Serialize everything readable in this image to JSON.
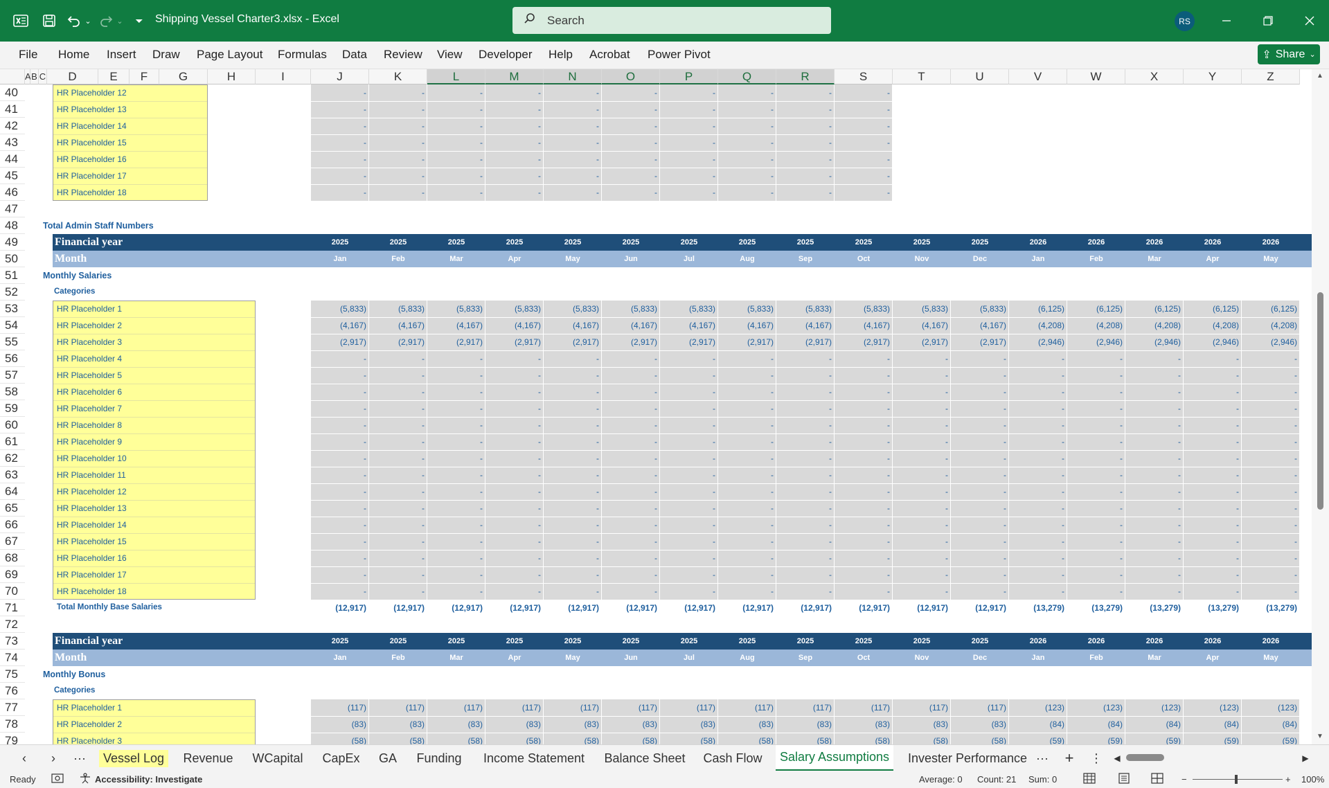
{
  "app": {
    "title": "Shipping Vessel Charter3.xlsx  -  Excel",
    "search_placeholder": "Search",
    "avatar_initials": "RS",
    "share_label": "Share"
  },
  "menu": [
    "File",
    "Home",
    "Insert",
    "Draw",
    "Page Layout",
    "Formulas",
    "Data",
    "Review",
    "View",
    "Developer",
    "Help",
    "Acrobat",
    "Power Pivot"
  ],
  "columns": [
    "A",
    "B",
    "C",
    "D",
    "E",
    "F",
    "G",
    "H",
    "I",
    "J",
    "K",
    "L",
    "M",
    "N",
    "O",
    "P",
    "Q",
    "R",
    "S",
    "T",
    "U",
    "V",
    "W",
    "X",
    "Y",
    "Z"
  ],
  "selected_columns": [
    "L",
    "M",
    "N",
    "O",
    "P",
    "Q",
    "R"
  ],
  "rows": [
    "40",
    "41",
    "42",
    "43",
    "44",
    "45",
    "46",
    "47",
    "48",
    "49",
    "50",
    "51",
    "52",
    "53",
    "54",
    "55",
    "56",
    "57",
    "58",
    "59",
    "60",
    "61",
    "62",
    "63",
    "64",
    "65",
    "66",
    "67",
    "68",
    "69",
    "70",
    "71",
    "72",
    "73",
    "74",
    "75",
    "76",
    "77",
    "78",
    "79"
  ],
  "sheet": {
    "top_list": [
      "HR Placeholder 12",
      "HR Placeholder 13",
      "HR Placeholder 14",
      "HR Placeholder 15",
      "HR Placeholder 16",
      "HR Placeholder 17",
      "HR Placeholder 18"
    ],
    "total_admin_title": "Total Admin Staff Numbers",
    "financial_year_label": "Financial year",
    "month_label": "Month",
    "years": [
      "2025",
      "2025",
      "2025",
      "2025",
      "2025",
      "2025",
      "2025",
      "2025",
      "2025",
      "2025",
      "2025",
      "2025",
      "2026",
      "2026",
      "2026",
      "2026",
      "2026"
    ],
    "months": [
      "Jan",
      "Feb",
      "Mar",
      "Apr",
      "May",
      "Jun",
      "Jul",
      "Aug",
      "Sep",
      "Oct",
      "Nov",
      "Dec",
      "Jan",
      "Feb",
      "Mar",
      "Apr",
      "May"
    ],
    "monthly_salaries_title": "Monthly Salaries",
    "categories_label": "Categories",
    "salary_list": [
      "HR Placeholder 1",
      "HR Placeholder 2",
      "HR Placeholder 3",
      "HR Placeholder 4",
      "HR Placeholder 5",
      "HR Placeholder 6",
      "HR Placeholder 7",
      "HR Placeholder 8",
      "HR Placeholder 9",
      "HR Placeholder 10",
      "HR Placeholder 11",
      "HR Placeholder 12",
      "HR Placeholder 13",
      "HR Placeholder 14",
      "HR Placeholder 15",
      "HR Placeholder 16",
      "HR Placeholder 17",
      "HR Placeholder 18"
    ],
    "salary_rows": [
      [
        "(5,833)",
        "(5,833)",
        "(5,833)",
        "(5,833)",
        "(5,833)",
        "(5,833)",
        "(5,833)",
        "(5,833)",
        "(5,833)",
        "(5,833)",
        "(5,833)",
        "(5,833)",
        "(6,125)",
        "(6,125)",
        "(6,125)",
        "(6,125)",
        "(6,125)"
      ],
      [
        "(4,167)",
        "(4,167)",
        "(4,167)",
        "(4,167)",
        "(4,167)",
        "(4,167)",
        "(4,167)",
        "(4,167)",
        "(4,167)",
        "(4,167)",
        "(4,167)",
        "(4,167)",
        "(4,208)",
        "(4,208)",
        "(4,208)",
        "(4,208)",
        "(4,208)"
      ],
      [
        "(2,917)",
        "(2,917)",
        "(2,917)",
        "(2,917)",
        "(2,917)",
        "(2,917)",
        "(2,917)",
        "(2,917)",
        "(2,917)",
        "(2,917)",
        "(2,917)",
        "(2,917)",
        "(2,946)",
        "(2,946)",
        "(2,946)",
        "(2,946)",
        "(2,946)"
      ]
    ],
    "dash": "-",
    "total_salaries_label": "Total Monthly Base Salaries",
    "total_salaries": [
      "(12,917)",
      "(12,917)",
      "(12,917)",
      "(12,917)",
      "(12,917)",
      "(12,917)",
      "(12,917)",
      "(12,917)",
      "(12,917)",
      "(12,917)",
      "(12,917)",
      "(12,917)",
      "(13,279)",
      "(13,279)",
      "(13,279)",
      "(13,279)",
      "(13,279)"
    ],
    "monthly_bonus_title": "Monthly Bonus",
    "bonus_list": [
      "HR Placeholder 1",
      "HR Placeholder 2",
      "HR Placeholder 3"
    ],
    "bonus_rows": [
      [
        "(117)",
        "(117)",
        "(117)",
        "(117)",
        "(117)",
        "(117)",
        "(117)",
        "(117)",
        "(117)",
        "(117)",
        "(117)",
        "(117)",
        "(123)",
        "(123)",
        "(123)",
        "(123)",
        "(123)"
      ],
      [
        "(83)",
        "(83)",
        "(83)",
        "(83)",
        "(83)",
        "(83)",
        "(83)",
        "(83)",
        "(83)",
        "(83)",
        "(83)",
        "(83)",
        "(84)",
        "(84)",
        "(84)",
        "(84)",
        "(84)"
      ],
      [
        "(58)",
        "(58)",
        "(58)",
        "(58)",
        "(58)",
        "(58)",
        "(58)",
        "(58)",
        "(58)",
        "(58)",
        "(58)",
        "(58)",
        "(59)",
        "(59)",
        "(59)",
        "(59)",
        "(59)"
      ]
    ]
  },
  "tabs": [
    "Vessel Log",
    "Revenue",
    "WCapital",
    "CapEx",
    "GA",
    "Funding",
    "Income Statement",
    "Balance Sheet",
    "Cash Flow",
    "Salary Assumptions",
    "Invester Performance"
  ],
  "active_tab": "Salary Assumptions",
  "status": {
    "ready": "Ready",
    "accessibility": "Accessibility: Investigate",
    "average": "Average: 0",
    "count": "Count: 21",
    "sum": "Sum: 0",
    "zoom": "100%"
  }
}
